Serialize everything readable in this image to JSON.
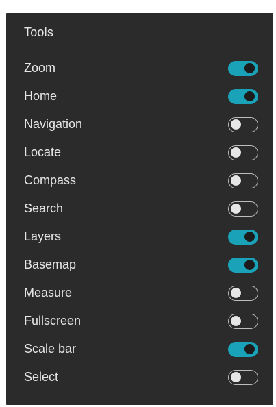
{
  "panel": {
    "title": "Tools"
  },
  "tools": [
    {
      "label": "Zoom",
      "enabled": true
    },
    {
      "label": "Home",
      "enabled": true
    },
    {
      "label": "Navigation",
      "enabled": false
    },
    {
      "label": "Locate",
      "enabled": false
    },
    {
      "label": "Compass",
      "enabled": false
    },
    {
      "label": "Search",
      "enabled": false
    },
    {
      "label": "Layers",
      "enabled": true
    },
    {
      "label": "Basemap",
      "enabled": true
    },
    {
      "label": "Measure",
      "enabled": false
    },
    {
      "label": "Fullscreen",
      "enabled": false
    },
    {
      "label": "Scale bar",
      "enabled": true
    },
    {
      "label": "Select",
      "enabled": false
    }
  ],
  "colors": {
    "panel_bg": "#2b2b2b",
    "text": "#e6e6e6",
    "toggle_on": "#1aa3b8",
    "toggle_off_border": "#bdbdbd"
  }
}
